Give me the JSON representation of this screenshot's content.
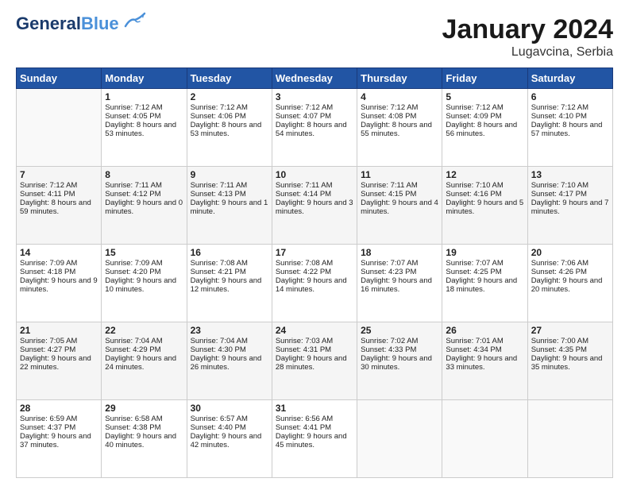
{
  "header": {
    "logo_line1": "General",
    "logo_line2": "Blue",
    "title": "January 2024",
    "subtitle": "Lugavcina, Serbia"
  },
  "days_of_week": [
    "Sunday",
    "Monday",
    "Tuesday",
    "Wednesday",
    "Thursday",
    "Friday",
    "Saturday"
  ],
  "weeks": [
    [
      {
        "day": "",
        "sunrise": "",
        "sunset": "",
        "daylight": ""
      },
      {
        "day": "1",
        "sunrise": "Sunrise: 7:12 AM",
        "sunset": "Sunset: 4:05 PM",
        "daylight": "Daylight: 8 hours and 53 minutes."
      },
      {
        "day": "2",
        "sunrise": "Sunrise: 7:12 AM",
        "sunset": "Sunset: 4:06 PM",
        "daylight": "Daylight: 8 hours and 53 minutes."
      },
      {
        "day": "3",
        "sunrise": "Sunrise: 7:12 AM",
        "sunset": "Sunset: 4:07 PM",
        "daylight": "Daylight: 8 hours and 54 minutes."
      },
      {
        "day": "4",
        "sunrise": "Sunrise: 7:12 AM",
        "sunset": "Sunset: 4:08 PM",
        "daylight": "Daylight: 8 hours and 55 minutes."
      },
      {
        "day": "5",
        "sunrise": "Sunrise: 7:12 AM",
        "sunset": "Sunset: 4:09 PM",
        "daylight": "Daylight: 8 hours and 56 minutes."
      },
      {
        "day": "6",
        "sunrise": "Sunrise: 7:12 AM",
        "sunset": "Sunset: 4:10 PM",
        "daylight": "Daylight: 8 hours and 57 minutes."
      }
    ],
    [
      {
        "day": "7",
        "sunrise": "Sunrise: 7:12 AM",
        "sunset": "Sunset: 4:11 PM",
        "daylight": "Daylight: 8 hours and 59 minutes."
      },
      {
        "day": "8",
        "sunrise": "Sunrise: 7:11 AM",
        "sunset": "Sunset: 4:12 PM",
        "daylight": "Daylight: 9 hours and 0 minutes."
      },
      {
        "day": "9",
        "sunrise": "Sunrise: 7:11 AM",
        "sunset": "Sunset: 4:13 PM",
        "daylight": "Daylight: 9 hours and 1 minute."
      },
      {
        "day": "10",
        "sunrise": "Sunrise: 7:11 AM",
        "sunset": "Sunset: 4:14 PM",
        "daylight": "Daylight: 9 hours and 3 minutes."
      },
      {
        "day": "11",
        "sunrise": "Sunrise: 7:11 AM",
        "sunset": "Sunset: 4:15 PM",
        "daylight": "Daylight: 9 hours and 4 minutes."
      },
      {
        "day": "12",
        "sunrise": "Sunrise: 7:10 AM",
        "sunset": "Sunset: 4:16 PM",
        "daylight": "Daylight: 9 hours and 5 minutes."
      },
      {
        "day": "13",
        "sunrise": "Sunrise: 7:10 AM",
        "sunset": "Sunset: 4:17 PM",
        "daylight": "Daylight: 9 hours and 7 minutes."
      }
    ],
    [
      {
        "day": "14",
        "sunrise": "Sunrise: 7:09 AM",
        "sunset": "Sunset: 4:18 PM",
        "daylight": "Daylight: 9 hours and 9 minutes."
      },
      {
        "day": "15",
        "sunrise": "Sunrise: 7:09 AM",
        "sunset": "Sunset: 4:20 PM",
        "daylight": "Daylight: 9 hours and 10 minutes."
      },
      {
        "day": "16",
        "sunrise": "Sunrise: 7:08 AM",
        "sunset": "Sunset: 4:21 PM",
        "daylight": "Daylight: 9 hours and 12 minutes."
      },
      {
        "day": "17",
        "sunrise": "Sunrise: 7:08 AM",
        "sunset": "Sunset: 4:22 PM",
        "daylight": "Daylight: 9 hours and 14 minutes."
      },
      {
        "day": "18",
        "sunrise": "Sunrise: 7:07 AM",
        "sunset": "Sunset: 4:23 PM",
        "daylight": "Daylight: 9 hours and 16 minutes."
      },
      {
        "day": "19",
        "sunrise": "Sunrise: 7:07 AM",
        "sunset": "Sunset: 4:25 PM",
        "daylight": "Daylight: 9 hours and 18 minutes."
      },
      {
        "day": "20",
        "sunrise": "Sunrise: 7:06 AM",
        "sunset": "Sunset: 4:26 PM",
        "daylight": "Daylight: 9 hours and 20 minutes."
      }
    ],
    [
      {
        "day": "21",
        "sunrise": "Sunrise: 7:05 AM",
        "sunset": "Sunset: 4:27 PM",
        "daylight": "Daylight: 9 hours and 22 minutes."
      },
      {
        "day": "22",
        "sunrise": "Sunrise: 7:04 AM",
        "sunset": "Sunset: 4:29 PM",
        "daylight": "Daylight: 9 hours and 24 minutes."
      },
      {
        "day": "23",
        "sunrise": "Sunrise: 7:04 AM",
        "sunset": "Sunset: 4:30 PM",
        "daylight": "Daylight: 9 hours and 26 minutes."
      },
      {
        "day": "24",
        "sunrise": "Sunrise: 7:03 AM",
        "sunset": "Sunset: 4:31 PM",
        "daylight": "Daylight: 9 hours and 28 minutes."
      },
      {
        "day": "25",
        "sunrise": "Sunrise: 7:02 AM",
        "sunset": "Sunset: 4:33 PM",
        "daylight": "Daylight: 9 hours and 30 minutes."
      },
      {
        "day": "26",
        "sunrise": "Sunrise: 7:01 AM",
        "sunset": "Sunset: 4:34 PM",
        "daylight": "Daylight: 9 hours and 33 minutes."
      },
      {
        "day": "27",
        "sunrise": "Sunrise: 7:00 AM",
        "sunset": "Sunset: 4:35 PM",
        "daylight": "Daylight: 9 hours and 35 minutes."
      }
    ],
    [
      {
        "day": "28",
        "sunrise": "Sunrise: 6:59 AM",
        "sunset": "Sunset: 4:37 PM",
        "daylight": "Daylight: 9 hours and 37 minutes."
      },
      {
        "day": "29",
        "sunrise": "Sunrise: 6:58 AM",
        "sunset": "Sunset: 4:38 PM",
        "daylight": "Daylight: 9 hours and 40 minutes."
      },
      {
        "day": "30",
        "sunrise": "Sunrise: 6:57 AM",
        "sunset": "Sunset: 4:40 PM",
        "daylight": "Daylight: 9 hours and 42 minutes."
      },
      {
        "day": "31",
        "sunrise": "Sunrise: 6:56 AM",
        "sunset": "Sunset: 4:41 PM",
        "daylight": "Daylight: 9 hours and 45 minutes."
      },
      {
        "day": "",
        "sunrise": "",
        "sunset": "",
        "daylight": ""
      },
      {
        "day": "",
        "sunrise": "",
        "sunset": "",
        "daylight": ""
      },
      {
        "day": "",
        "sunrise": "",
        "sunset": "",
        "daylight": ""
      }
    ]
  ]
}
